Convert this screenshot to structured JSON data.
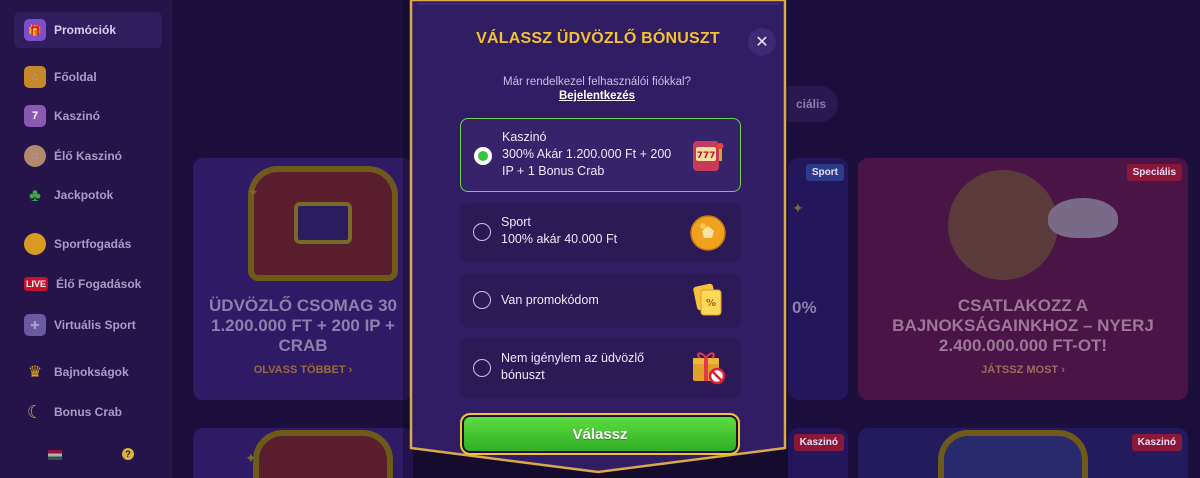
{
  "sidebar": {
    "items": [
      {
        "label": "Promóciók",
        "icon": "promotions-icon"
      },
      {
        "label": "Főoldal",
        "icon": "home-icon"
      },
      {
        "label": "Kaszinó",
        "icon": "casino-icon"
      },
      {
        "label": "Élő Kaszinó",
        "icon": "live-casino-icon"
      },
      {
        "label": "Jackpotok",
        "icon": "clover-icon"
      },
      {
        "label": "Sportfogadás",
        "icon": "sports-ball-icon"
      },
      {
        "label": "Élő Fogadások",
        "icon": "live-badge-icon",
        "badge": "LIVE"
      },
      {
        "label": "Virtuális Sport",
        "icon": "gamepad-icon"
      },
      {
        "label": "Bajnokságok",
        "icon": "trophy-icon"
      },
      {
        "label": "Bonus Crab",
        "icon": "crab-icon"
      }
    ],
    "help_symbol": "?"
  },
  "background": {
    "filter_pill": "ciális",
    "cards": [
      {
        "title": "ÜDVÖZLŐ CSOMAG 30 1.200.000 FT + 200 IP + CRAB",
        "link": "OLVASS TÖBBET"
      },
      {
        "tag": "Sport",
        "title": "0%"
      },
      {
        "tag": "Speciális",
        "title": "CSATLAKOZZ A BAJNOKSÁGAINKHOZ – NYERJ 2.400.000.000 FT-OT!",
        "link": "JÁTSSZ MOST"
      },
      {
        "tag": "Kaszinó"
      },
      {
        "tag": "Kaszinó"
      }
    ]
  },
  "modal": {
    "title": "VÁLASSZ ÜDVÖZLŐ BÓNUSZT",
    "close_symbol": "✕",
    "login_question": "Már rendelkezel felhasználói fiókkal?",
    "login_link": "Bejelentkezés",
    "options": [
      {
        "name": "Kaszinó",
        "description": "300% Akár 1.200.000 Ft + 200 IP + 1 Bonus Crab",
        "icon": "slot-machine-icon",
        "selected": true
      },
      {
        "name": "Sport",
        "description": "100% akár 40.000 Ft",
        "icon": "soccer-ball-icon",
        "selected": false
      },
      {
        "name": "Van promokódom",
        "icon": "promo-ticket-icon",
        "selected": false
      },
      {
        "name": "Nem igénylem az üdvözlő bónuszt",
        "icon": "no-gift-icon",
        "selected": false
      }
    ],
    "submit_label": "Válassz"
  },
  "colors": {
    "accent_gold": "#f2c230",
    "accent_green": "#35c43a",
    "modal_bg": "#311d63"
  }
}
